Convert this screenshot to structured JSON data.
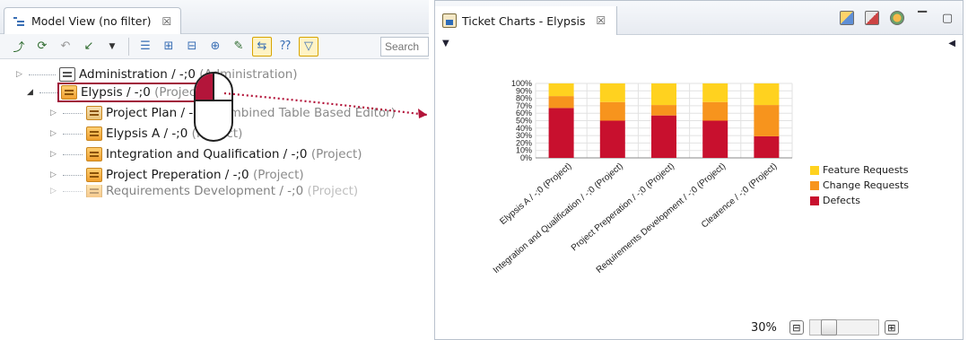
{
  "model_view": {
    "tab_title": "Model View (no filter)",
    "tab_close": "☒",
    "search_placeholder": "Search",
    "tree": [
      {
        "label": "Administration / -;0",
        "suffix": "(Administration)",
        "icon": "building-icon",
        "expanded": false
      },
      {
        "label": "Elypsis / -;0",
        "suffix": "(Project)",
        "icon": "project-icon",
        "expanded": true,
        "selected": true
      },
      {
        "label": "Project Plan / -;0",
        "suffix": "(Combined Table Based Editor)",
        "icon": "table-icon",
        "child": true
      },
      {
        "label": "Elypsis A / -;0",
        "suffix": "(Project)",
        "icon": "project-icon",
        "child": true
      },
      {
        "label": "Integration and Qualification / -;0",
        "suffix": "(Project)",
        "icon": "project-icon",
        "child": true
      },
      {
        "label": "Project Preperation / -;0",
        "suffix": "(Project)",
        "icon": "project-icon",
        "child": true
      },
      {
        "label": "Requirements Development / -;0",
        "suffix": "(Project)",
        "icon": "project-icon",
        "child": true
      }
    ]
  },
  "ticket_charts": {
    "tab_title": "Ticket Charts - Elypsis",
    "tab_close": "☒",
    "zoom_label": "30%",
    "zoom_value": 0.3,
    "zoom_minus": "⊟",
    "zoom_plus": "⊞"
  },
  "chart_data": {
    "type": "bar",
    "stacked": true,
    "categories": [
      "Elypsis A / -;0 (Project)",
      "Integration and Qualification / -;0 (Project)",
      "Project Preperation / -;0 (Project)",
      "Requirements Development / -;0 (Project)",
      "Clearence / -;0 (Project)"
    ],
    "series": [
      {
        "name": "Defects",
        "color": "#c8102e",
        "values": [
          67,
          50,
          57,
          50,
          29
        ]
      },
      {
        "name": "Change Requests",
        "color": "#f7941d",
        "values": [
          16,
          25,
          14,
          25,
          42
        ]
      },
      {
        "name": "Feature Requests",
        "color": "#ffd21f",
        "values": [
          17,
          25,
          29,
          25,
          29
        ]
      }
    ],
    "y_ticks": [
      "0%",
      "10%",
      "20%",
      "30%",
      "40%",
      "50%",
      "60%",
      "70%",
      "80%",
      "90%",
      "100%"
    ],
    "ylim": [
      0,
      100
    ],
    "legend_order": [
      "Feature Requests",
      "Change Requests",
      "Defects"
    ],
    "legend_placement": "right",
    "grid": true
  }
}
